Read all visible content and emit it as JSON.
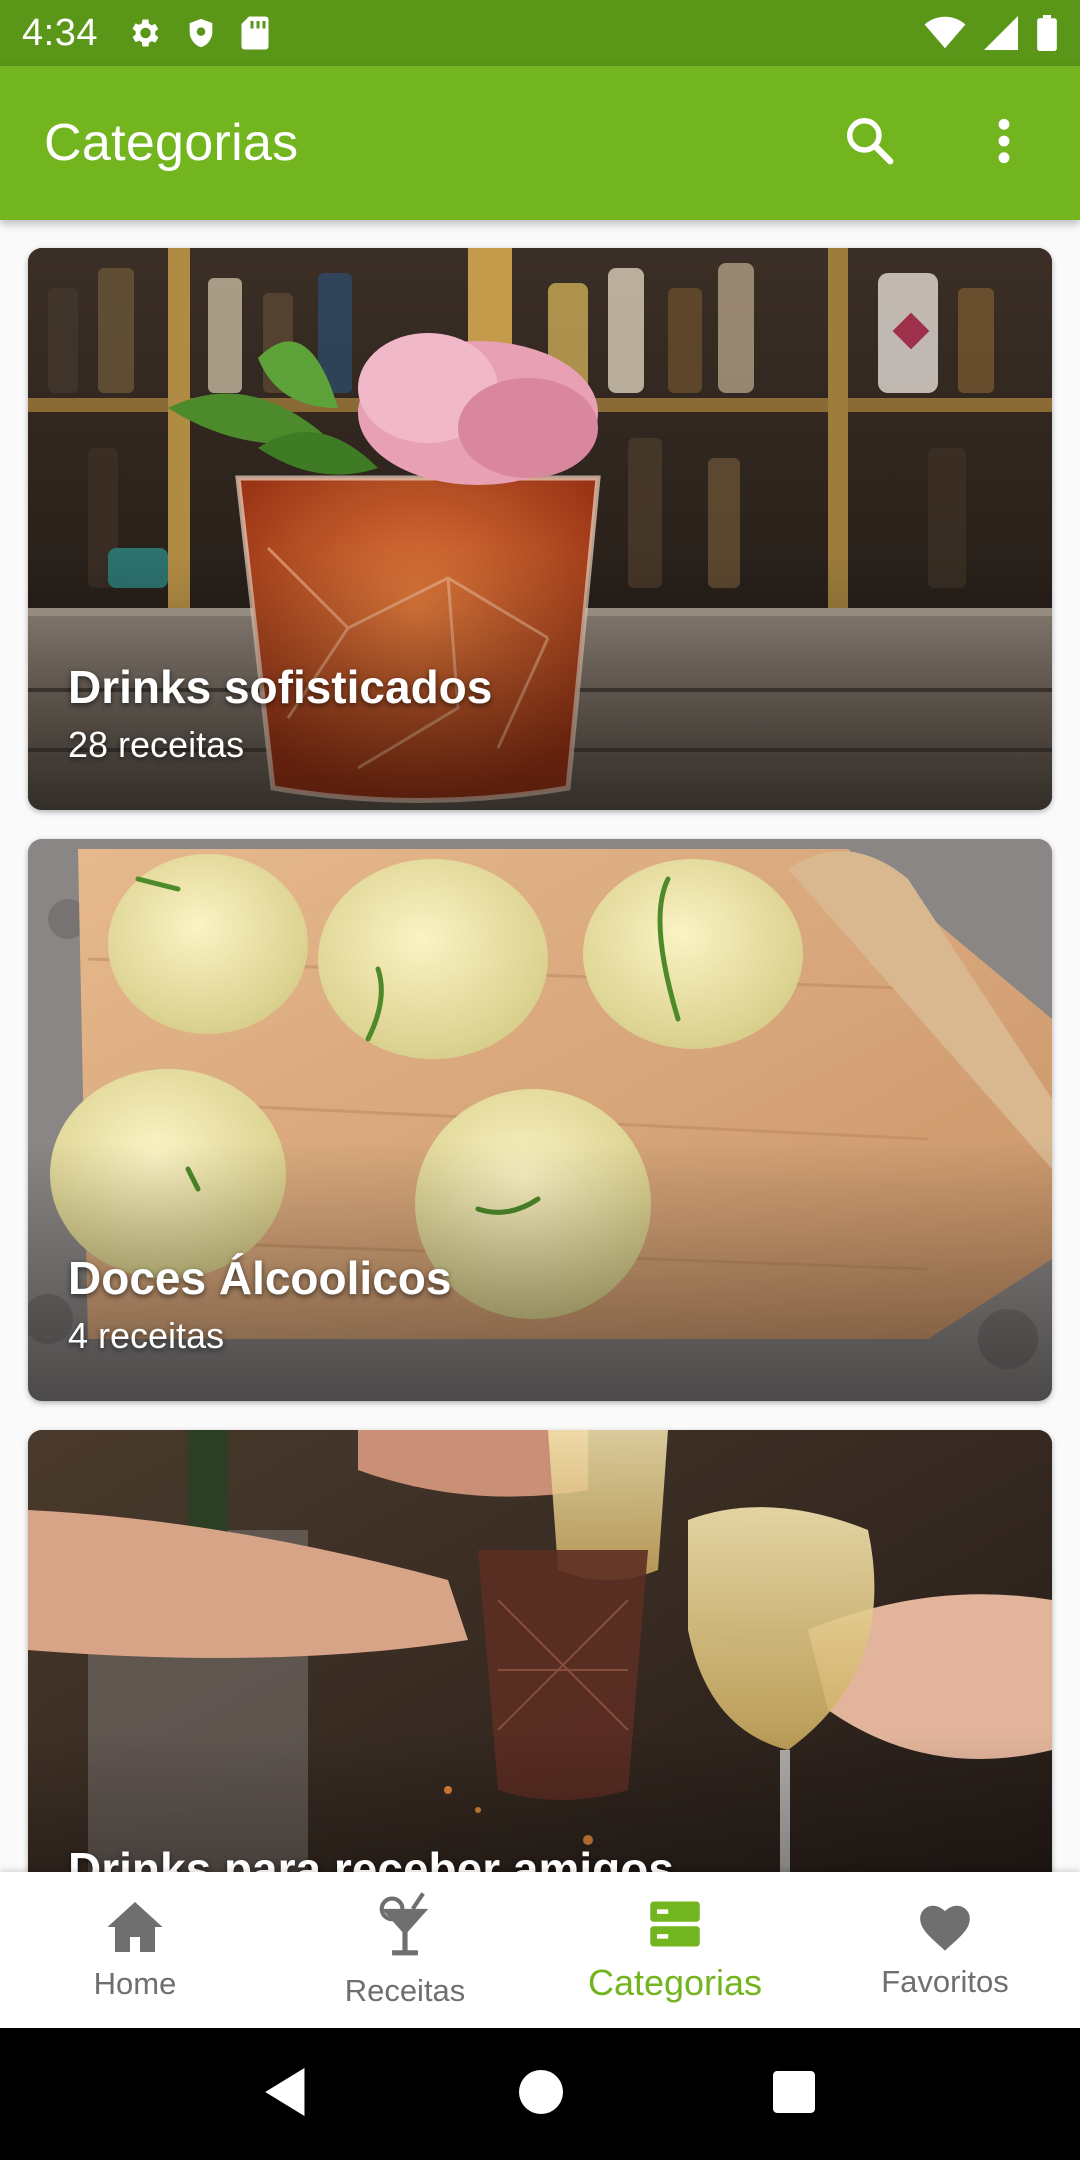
{
  "status_bar": {
    "time": "4:34",
    "left_icons": [
      "gear-icon",
      "shield-icon",
      "sd-card-icon"
    ],
    "right_icons": [
      "wifi-icon",
      "signal-icon",
      "battery-icon"
    ],
    "color": "#5a9617"
  },
  "app_bar": {
    "title": "Categorias",
    "actions": [
      "search-icon",
      "more-vert-icon"
    ],
    "color": "#72b51f"
  },
  "categories": [
    {
      "title": "Drinks sofisticados",
      "count": "28 receitas"
    },
    {
      "title": "Doces Álcoolicos",
      "count": "4 receitas"
    },
    {
      "title": "Drinks para receber amigos",
      "count": ""
    }
  ],
  "bottom_nav": {
    "items": [
      {
        "label": "Home",
        "icon": "home-icon",
        "active": false
      },
      {
        "label": "Receitas",
        "icon": "cocktail-icon",
        "active": false
      },
      {
        "label": "Categorias",
        "icon": "categories-icon",
        "active": true
      },
      {
        "label": "Favoritos",
        "icon": "heart-icon",
        "active": false
      }
    ],
    "active_color": "#72b51f",
    "inactive_color": "#6f6f6f"
  },
  "system_nav": [
    "back-icon",
    "home-circle-icon",
    "recents-icon"
  ]
}
